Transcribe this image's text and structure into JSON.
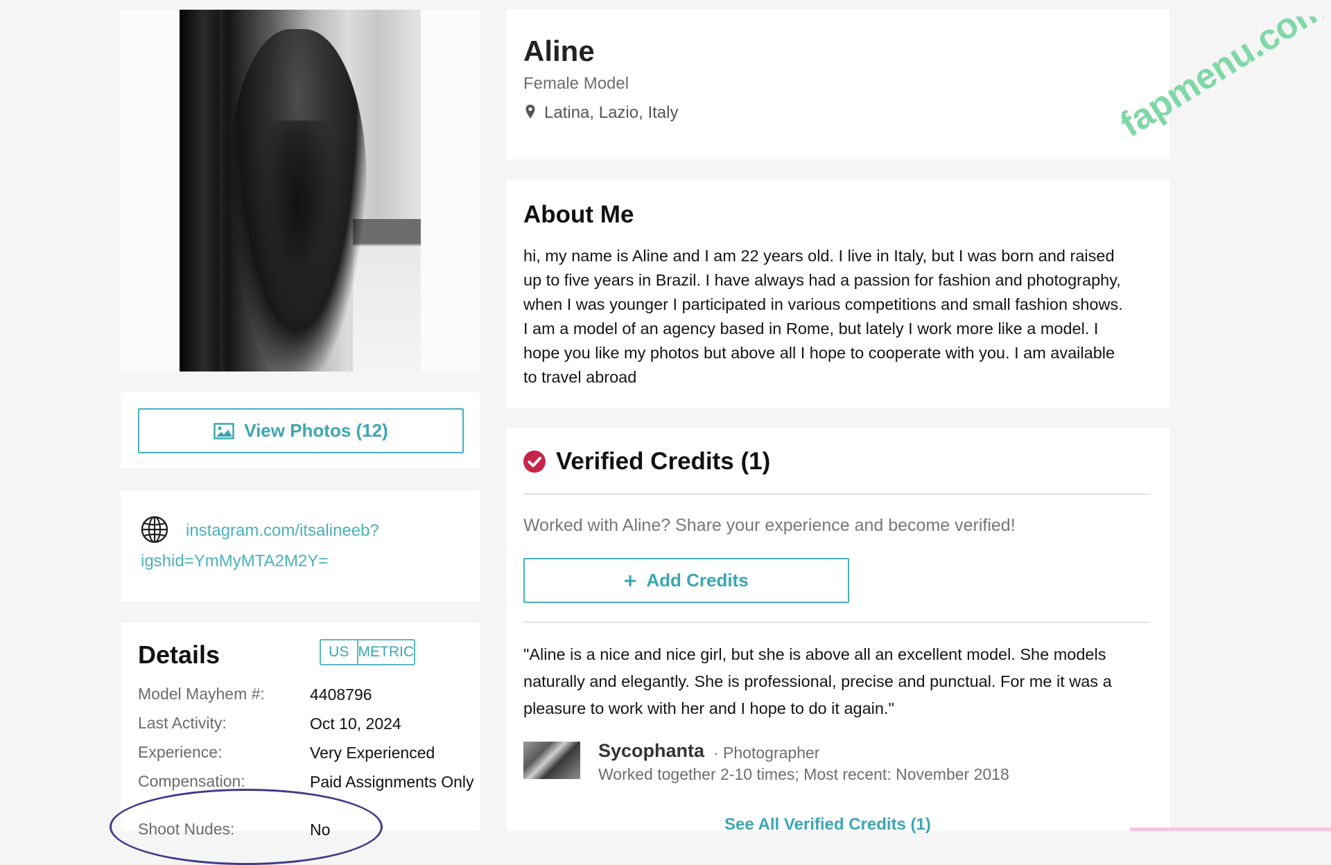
{
  "photo": {
    "alt": "Profile photo"
  },
  "view_photos": {
    "label": "View Photos (12)",
    "icon": "image-icon"
  },
  "links": {
    "line1": "instagram.com/itsalineeb?",
    "line2": "igshid=YmMyMTA2M2Y=",
    "icon": "globe-icon"
  },
  "details": {
    "title": "Details",
    "units": [
      "US",
      "METRIC"
    ],
    "rows": [
      {
        "label": "Model Mayhem #:",
        "value": "4408796"
      },
      {
        "label": "Last Activity:",
        "value": "Oct 10, 2024"
      },
      {
        "label": "Experience:",
        "value": "Very Experienced"
      },
      {
        "label": "Compensation:",
        "value": "Paid Assignments Only"
      },
      {
        "label": "Shoot Nudes:",
        "value": "No"
      }
    ]
  },
  "profile": {
    "name": "Aline",
    "type": "Female Model",
    "location": "Latina, Lazio, Italy"
  },
  "watermark": "fapmenu.com",
  "about": {
    "title": "About Me",
    "lines": [
      "hi, my name is Aline and I am 22 years old. I live in Italy, but I was born and raised",
      "up to five years in Brazil. I have always had a passion for fashion and photography,",
      "when I was younger I participated in various competitions and small fashion shows.",
      "I am a model of an agency based in Rome, but lately I work more like a model. I",
      "hope you like my photos but above all I hope to cooperate with you. I am available",
      "to travel abroad"
    ]
  },
  "credits": {
    "title": "Verified Credits (1)",
    "prompt": "Worked with Aline? Share your experience and become verified!",
    "add_label": "Add Credits",
    "quote_lines": [
      "\"Aline is a nice and nice girl, but she is above all an excellent model. She models",
      "naturally and elegantly. She is professional, precise and punctual. For me it was a",
      "pleasure to work with her and I hope to do it again.\""
    ],
    "credit_name": "Sycophanta",
    "credit_role": "· Photographer",
    "credit_detail": "Worked together 2-10 times; Most recent: November 2018",
    "see_all": "See All Verified Credits (1)"
  },
  "colors": {
    "accent": "#3aa6b4",
    "verified": "#c8254b",
    "watermark": "#7fd8a6",
    "annotation": "#3e3a8c"
  }
}
